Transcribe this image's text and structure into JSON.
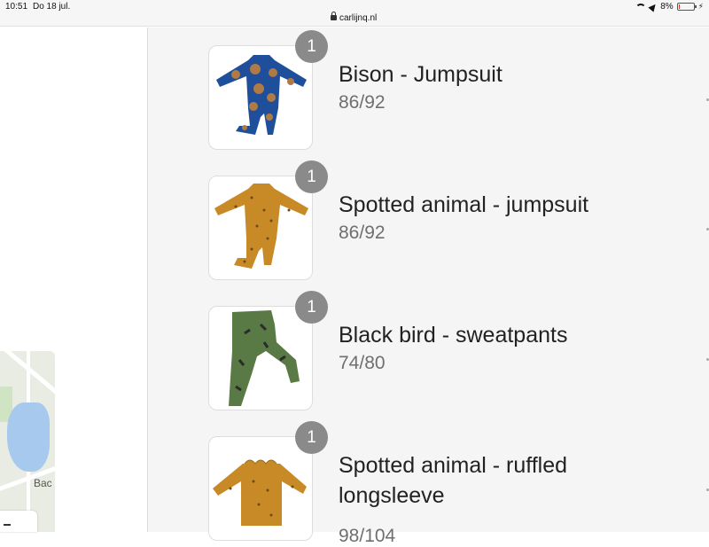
{
  "status_bar": {
    "time": "10:51",
    "date": "Do 18 jul.",
    "url": "carlijnq.nl",
    "battery": "8%",
    "battery_level": 0.08
  },
  "map": {
    "label": "Bac"
  },
  "order_items": [
    {
      "quantity": "1",
      "name": "Bison - Jumpsuit",
      "size": "86/92",
      "image": "bison-jumpsuit-photo",
      "garment_color": "#1f4f9a",
      "print_color": "#b07a45"
    },
    {
      "quantity": "1",
      "name": "Spotted animal - jumpsuit",
      "size": "86/92",
      "image": "spotted-animal-jumpsuit-photo",
      "garment_color": "#c88a26",
      "print_color": "#6b4a1a"
    },
    {
      "quantity": "1",
      "name": "Black bird - sweatpants",
      "size": "74/80",
      "image": "black-bird-sweatpants-photo",
      "garment_color": "#5a7a45",
      "print_color": "#2b2b2b"
    },
    {
      "quantity": "1",
      "name": "Spotted animal - ruffled longsleeve",
      "size": "98/104",
      "image": "spotted-animal-longsleeve-photo",
      "garment_color": "#c88a26",
      "print_color": "#6b4a1a"
    }
  ]
}
